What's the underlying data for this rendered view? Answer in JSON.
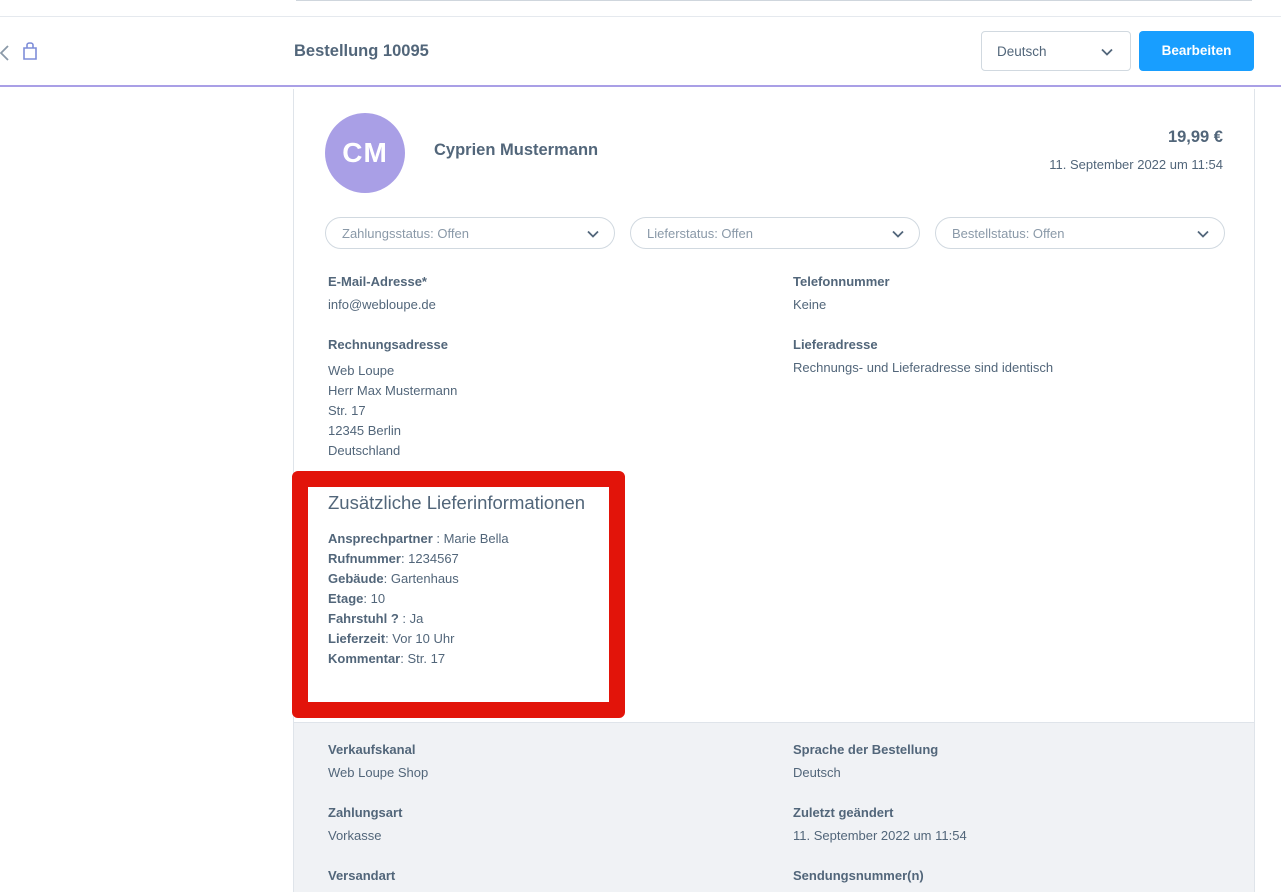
{
  "header": {
    "order_title": "Bestellung 10095",
    "language_value": "Deutsch",
    "edit_label": "Bearbeiten"
  },
  "customer": {
    "initials": "CM",
    "name": "Cyprien Mustermann",
    "total": "19,99 €",
    "date": "11. September 2022 um 11:54"
  },
  "statuses": {
    "payment": "Zahlungsstatus: Offen",
    "delivery": "Lieferstatus: Offen",
    "order": "Bestellstatus: Offen"
  },
  "contact": {
    "email_label": "E-Mail-Adresse*",
    "email_value": "info@webloupe.de",
    "phone_label": "Telefonnummer",
    "phone_value": "Keine"
  },
  "billing": {
    "label": "Rechnungsadresse",
    "lines": [
      "Web Loupe",
      "Herr Max Mustermann",
      "Str. 17",
      "12345 Berlin",
      "Deutschland"
    ]
  },
  "shipping": {
    "label": "Lieferadresse",
    "value": "Rechnungs- und Lieferadresse sind identisch"
  },
  "extra_info": {
    "title": "Zusätzliche Lieferinformationen",
    "rows": [
      {
        "key": "Ansprechpartner",
        "value": " : Marie Bella"
      },
      {
        "key": "Rufnummer",
        "value": ": 1234567"
      },
      {
        "key": "Gebäude",
        "value": ": Gartenhaus"
      },
      {
        "key": "Etage",
        "value": ": 10"
      },
      {
        "key": "Fahrstuhl ?",
        "value": " : Ja"
      },
      {
        "key": "Lieferzeit",
        "value": ": Vor 10 Uhr"
      },
      {
        "key": "Kommentar",
        "value": ": Str. 17"
      }
    ]
  },
  "details": {
    "sales_channel_label": "Verkaufskanal",
    "sales_channel_value": "Web Loupe Shop",
    "order_language_label": "Sprache der Bestellung",
    "order_language_value": "Deutsch",
    "payment_method_label": "Zahlungsart",
    "payment_method_value": "Vorkasse",
    "last_changed_label": "Zuletzt geändert",
    "last_changed_value": "11. September 2022 um 11:54",
    "shipping_method_label": "Versandart",
    "tracking_label": "Sendungsnummer(n)"
  },
  "colors": {
    "accent": "#189eff",
    "avatar": "#a99fe6",
    "highlight": "#e2140a",
    "text": "#52667a"
  },
  "icons": {
    "back": "chevron-left-icon",
    "bag": "shopping-bag-icon",
    "dropdown": "chevron-down-icon"
  }
}
